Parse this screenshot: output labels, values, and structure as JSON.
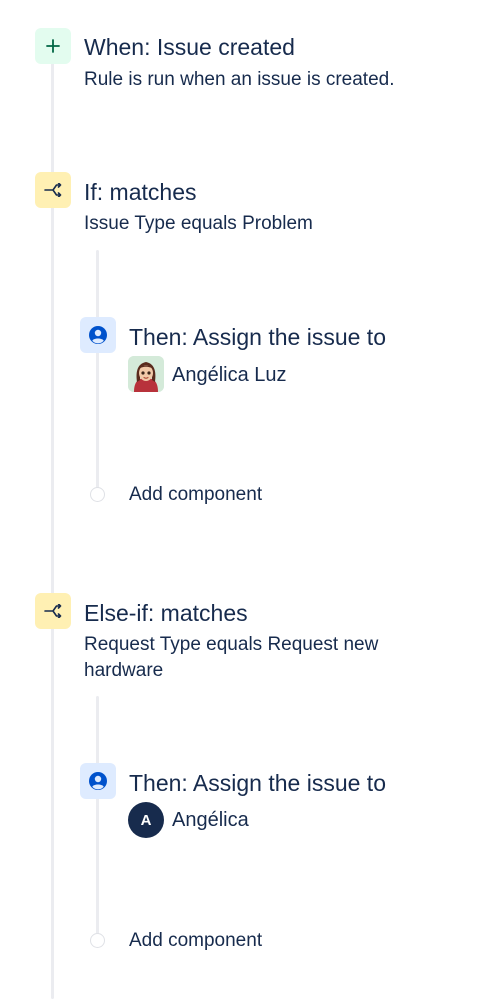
{
  "rule": {
    "trigger": {
      "title": "When: Issue created",
      "description": "Rule is run when an issue is created.",
      "icon": "plus-icon",
      "color": "#e3fcef"
    },
    "if_condition": {
      "title": "If: matches",
      "description": "Issue Type equals Problem",
      "icon": "branch-icon",
      "color": "#fff0b3",
      "action": {
        "title": "Then: Assign the issue to",
        "assignee": "Angélica Luz",
        "icon": "user-circle-icon",
        "color": "#deebff"
      },
      "add_component": "Add component"
    },
    "else_if_condition": {
      "title": "Else-if: matches",
      "description": "Request Type equals Request new hardware",
      "icon": "branch-icon",
      "color": "#fff0b3",
      "action": {
        "title": "Then: Assign the issue to",
        "assignee": "Angélica",
        "assignee_initial": "A",
        "icon": "user-circle-icon",
        "color": "#deebff"
      },
      "add_component": "Add component"
    }
  }
}
